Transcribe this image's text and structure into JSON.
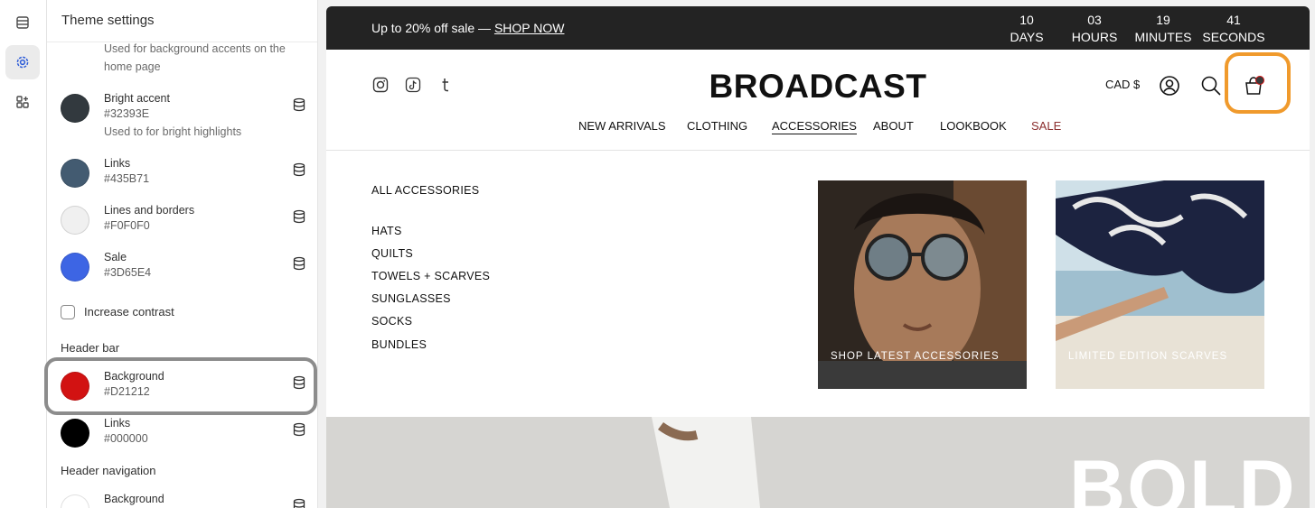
{
  "rail": {
    "icons": [
      "sections-icon",
      "theme-settings-icon",
      "apps-icon"
    ]
  },
  "panel": {
    "title": "Theme settings",
    "top_desc": "Used for background accents on the home page",
    "colors": [
      {
        "name": "Bright accent",
        "hex": "#32393E",
        "desc": "Used to for bright highlights",
        "color": "#32393E"
      },
      {
        "name": "Links",
        "hex": "#435B71",
        "color": "#435B71"
      },
      {
        "name": "Lines and borders",
        "hex": "#F0F0F0",
        "color": "#F0F0F0"
      },
      {
        "name": "Sale",
        "hex": "#3D65E4",
        "color": "#3D65E4"
      }
    ],
    "increase_contrast": "Increase contrast",
    "header_bar_label": "Header bar",
    "header_bar": [
      {
        "name": "Background",
        "hex": "#D21212",
        "color": "#D21212"
      },
      {
        "name": "Links",
        "hex": "#000000",
        "color": "#000000"
      }
    ],
    "header_nav_label": "Header navigation",
    "header_nav": [
      {
        "name": "Background",
        "color": "#FFFFFF"
      }
    ]
  },
  "preview": {
    "announcement": {
      "text": "Up to 20% off sale — ",
      "link": "SHOP NOW"
    },
    "countdown": [
      {
        "value": "10",
        "unit": "DAYS"
      },
      {
        "value": "03",
        "unit": "HOURS"
      },
      {
        "value": "19",
        "unit": "MINUTES"
      },
      {
        "value": "41",
        "unit": "SECONDS"
      }
    ],
    "logo": "BROADCAST",
    "currency": "CAD $",
    "nav": [
      "NEW ARRIVALS",
      "CLOTHING",
      "ACCESSORIES",
      "ABOUT",
      "LOOKBOOK",
      "SALE"
    ],
    "mega": {
      "all": "ALL ACCESSORIES",
      "links": [
        "HATS",
        "QUILTS",
        "TOWELS + SCARVES",
        "SUNGLASSES",
        "SOCKS",
        "BUNDLES"
      ],
      "cards": [
        "SHOP LATEST ACCESSORIES",
        "LIMITED EDITION SCARVES"
      ]
    },
    "hero_text": "BOLD"
  }
}
